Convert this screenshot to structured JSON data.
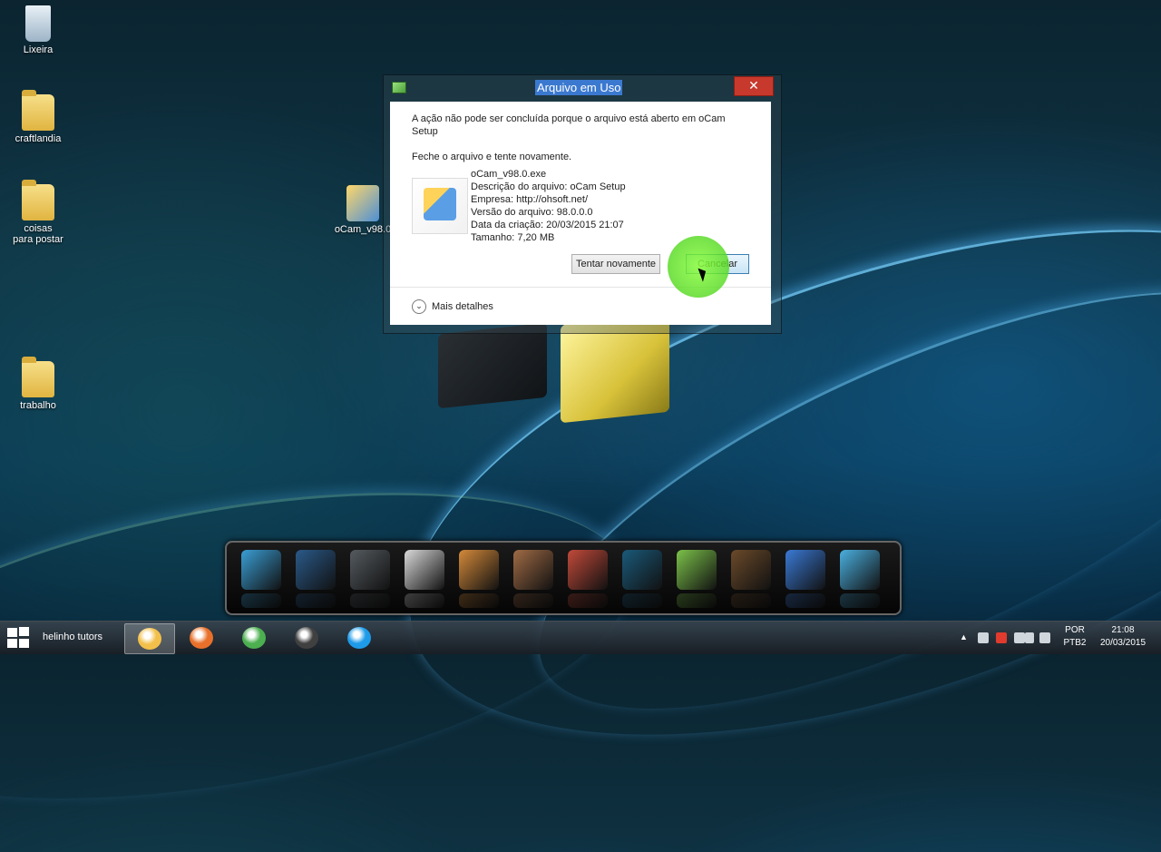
{
  "desktop": {
    "icons": [
      {
        "label": "Lixeira",
        "icon": "recycle-bin-icon"
      },
      {
        "label": "craftlandia",
        "icon": "folder-icon"
      },
      {
        "label": "coisas para postar",
        "icon": "folder-icon"
      },
      {
        "label": "oCam_v98.0",
        "icon": "installer-icon"
      },
      {
        "label": "trabalho",
        "icon": "folder-icon"
      }
    ]
  },
  "dialog": {
    "title": "Arquivo em Uso",
    "close_label": "✕",
    "message": "A ação não pode ser concluída porque o arquivo está aberto em oCam Setup",
    "instruction": "Feche o arquivo e tente novamente.",
    "file": {
      "name": "oCam_v98.0.exe",
      "description": "Descrição do arquivo: oCam Setup",
      "company": "Empresa: http://ohsoft.net/",
      "version": "Versão do arquivo: 98.0.0.0",
      "created": "Data da criação: 20/03/2015 21:07",
      "size": "Tamanho: 7,20 MB"
    },
    "retry_label": "Tentar novamente",
    "cancel_label": "Cancelar",
    "details_label": "Mais detalhes"
  },
  "dock": {
    "items": [
      "launcher-icon",
      "steam-icon",
      "game-emblem-icon",
      "counter-strike-icon",
      "gta-icon",
      "gta-sa-icon",
      "ktg-icon",
      "cinema4d-icon",
      "minecraft-map-icon",
      "minecraft-steve-icon",
      "windows-icon",
      "camera-icon"
    ],
    "colors": [
      "#3a9fd6",
      "#2a5a8a",
      "#555b60",
      "#dadada",
      "#d58a3a",
      "#a06b45",
      "#c24a3a",
      "#1a5a7a",
      "#7cc24a",
      "#6b4a2a",
      "#3a7ad6",
      "#4ab0e0"
    ]
  },
  "taskbar": {
    "user": "helinho tutors",
    "apps": [
      {
        "name": "file-explorer-icon",
        "color": "#f2c04a",
        "active": true
      },
      {
        "name": "firefox-icon",
        "color": "#e8702a",
        "active": false
      },
      {
        "name": "chrome-icon",
        "color": "#4caf50",
        "active": false
      },
      {
        "name": "media-player-icon",
        "color": "#404040",
        "active": false
      },
      {
        "name": "skype-icon",
        "color": "#1e9be8",
        "active": false
      }
    ],
    "language_top": "POR",
    "language_bottom": "PTB2",
    "time": "21:08",
    "date": "20/03/2015"
  }
}
